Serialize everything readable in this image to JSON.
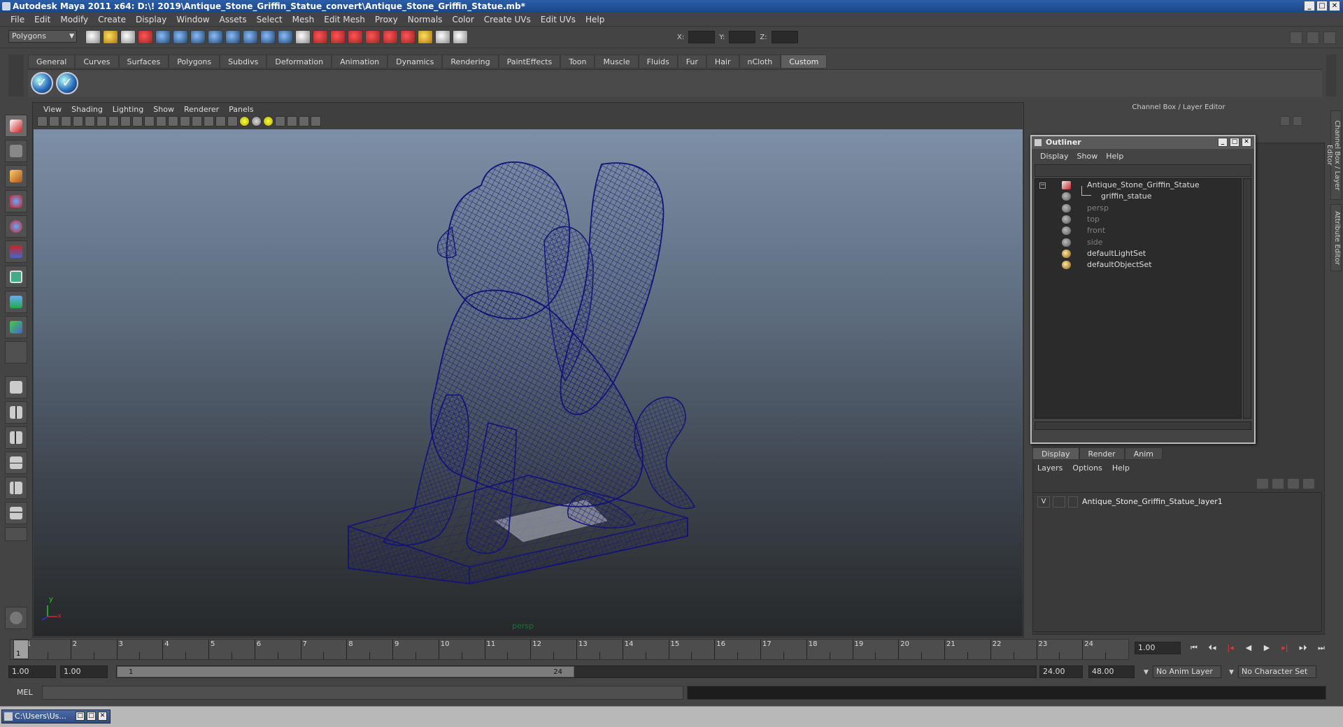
{
  "window": {
    "title": "Autodesk Maya 2011 x64: D:\\! 2019\\Antique_Stone_Griffin_Statue_convert\\Antique_Stone_Griffin_Statue.mb*",
    "minimize": "_",
    "maximize": "□",
    "close": "✕"
  },
  "menubar": [
    "File",
    "Edit",
    "Modify",
    "Create",
    "Display",
    "Window",
    "Assets",
    "Select",
    "Mesh",
    "Edit Mesh",
    "Proxy",
    "Normals",
    "Color",
    "Create UVs",
    "Edit UVs",
    "Help"
  ],
  "statusline": {
    "mode": "Polygons",
    "x_label": "X:",
    "y_label": "Y:",
    "z_label": "Z:"
  },
  "shelf": {
    "tabs": [
      "General",
      "Curves",
      "Surfaces",
      "Polygons",
      "Subdivs",
      "Deformation",
      "Animation",
      "Dynamics",
      "Rendering",
      "PaintEffects",
      "Toon",
      "Muscle",
      "Fluids",
      "Fur",
      "Hair",
      "nCloth",
      "Custom"
    ],
    "active_tab": "Custom",
    "buttons": [
      "✓",
      "✓"
    ]
  },
  "viewport": {
    "menu": [
      "View",
      "Shading",
      "Lighting",
      "Show",
      "Renderer",
      "Panels"
    ],
    "camera": "persp",
    "axis_y": "y",
    "axis_x": "x",
    "wire_color": "#12127a"
  },
  "dock": {
    "header": "Channel Box / Layer Editor",
    "side_tab_1": "Channel Box / Layer Editor",
    "side_tab_2": "Attribute Editor"
  },
  "outliner": {
    "title": "Outliner",
    "menu": [
      "Display",
      "Show",
      "Help"
    ],
    "expander": "−",
    "items": [
      {
        "label": "Antique_Stone_Griffin_Statue",
        "icon": "mesh-icon",
        "dim": false
      },
      {
        "label": "griffin_statue",
        "icon": "mesh-child-icon",
        "dim": false
      },
      {
        "label": "persp",
        "icon": "camera-icon",
        "dim": true
      },
      {
        "label": "top",
        "icon": "camera-icon",
        "dim": true
      },
      {
        "label": "front",
        "icon": "camera-icon",
        "dim": true
      },
      {
        "label": "side",
        "icon": "camera-icon",
        "dim": true
      },
      {
        "label": "defaultLightSet",
        "icon": "set-icon",
        "dim": false
      },
      {
        "label": "defaultObjectSet",
        "icon": "set-icon",
        "dim": false
      }
    ]
  },
  "layer_editor": {
    "tabs": [
      "Display",
      "Render",
      "Anim"
    ],
    "active_tab": "Display",
    "menu": [
      "Layers",
      "Options",
      "Help"
    ],
    "layer": {
      "visibility": "V",
      "name": "Antique_Stone_Griffin_Statue_layer1"
    }
  },
  "timeline": {
    "ticks": [
      "1",
      "2",
      "3",
      "4",
      "5",
      "6",
      "7",
      "8",
      "9",
      "10",
      "11",
      "12",
      "13",
      "14",
      "15",
      "16",
      "17",
      "18",
      "19",
      "20",
      "21",
      "22",
      "23",
      "24"
    ],
    "current_frame": "1",
    "current_time": "1.00",
    "playback": [
      "⏮",
      "⏴◂",
      "|◂",
      "◀",
      "▶",
      "▸|",
      "▸⏵",
      "⏭"
    ]
  },
  "range": {
    "start_time": "1.00",
    "playback_start": "1.00",
    "handle_start": "1",
    "handle_end": "24",
    "playback_end": "24.00",
    "end_time": "48.00",
    "anim_layer": "No Anim Layer",
    "character_set": "No Character Set"
  },
  "command_line": {
    "label": "MEL"
  },
  "taskbar": {
    "item": "C:\\Users\\Us..."
  }
}
